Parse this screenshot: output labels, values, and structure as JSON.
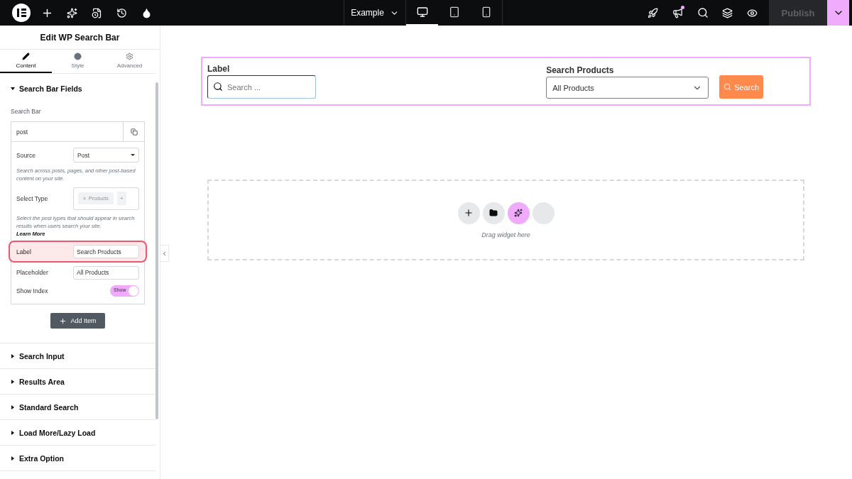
{
  "topbar": {
    "document": "Example",
    "devices": [
      {
        "kind": "desktop",
        "selected": true
      },
      {
        "kind": "tablet",
        "selected": false
      },
      {
        "kind": "mobile",
        "selected": false
      }
    ],
    "notification": true,
    "publish": {
      "label": "Publish",
      "disabled": true
    }
  },
  "panel": {
    "title": "Edit WP Search Bar",
    "tabs": [
      {
        "kind": "content",
        "label": "Content",
        "selected": true
      },
      {
        "kind": "style",
        "label": "Style",
        "selected": false
      },
      {
        "kind": "advanced",
        "label": "Advanced",
        "selected": false
      }
    ],
    "sections": [
      {
        "title": "Search Bar Fields",
        "expanded": true
      },
      {
        "title": "Search Input",
        "expanded": false
      },
      {
        "title": "Results Area",
        "expanded": false
      },
      {
        "title": "Standard Search",
        "expanded": false
      },
      {
        "title": "Load More/Lazy Load",
        "expanded": false
      },
      {
        "title": "Extra Option",
        "expanded": false
      }
    ],
    "repeater": {
      "label": "Search Bar",
      "item_title": "post",
      "fields": [
        {
          "kind": "select",
          "label": "Source",
          "value": "Post",
          "highlighted": false
        },
        {
          "kind": "note",
          "text": "Search across posts, pages, and other post-based content on your site."
        },
        {
          "kind": "tags",
          "label": "Select Type",
          "tag": "Products",
          "remove": "×",
          "add": "+"
        },
        {
          "kind": "note",
          "text": "Select the post types that should appear in search results when users search your site.",
          "link": "Learn More"
        },
        {
          "kind": "text",
          "label": "Label",
          "value": "Search Products",
          "highlighted": true
        },
        {
          "kind": "text",
          "label": "Placeholder",
          "value": "All Products",
          "highlighted": false
        },
        {
          "kind": "switch",
          "label": "Show Index",
          "on": true,
          "text": "Show"
        }
      ],
      "add_button": "Add Item"
    }
  },
  "canvas": {
    "widget": {
      "search_label": "Label",
      "search_placeholder": "Search ...",
      "select_label": "Search Products",
      "select_value": "All Products",
      "button": "Search"
    },
    "dropzone": {
      "hint": "Drag widget here"
    }
  }
}
